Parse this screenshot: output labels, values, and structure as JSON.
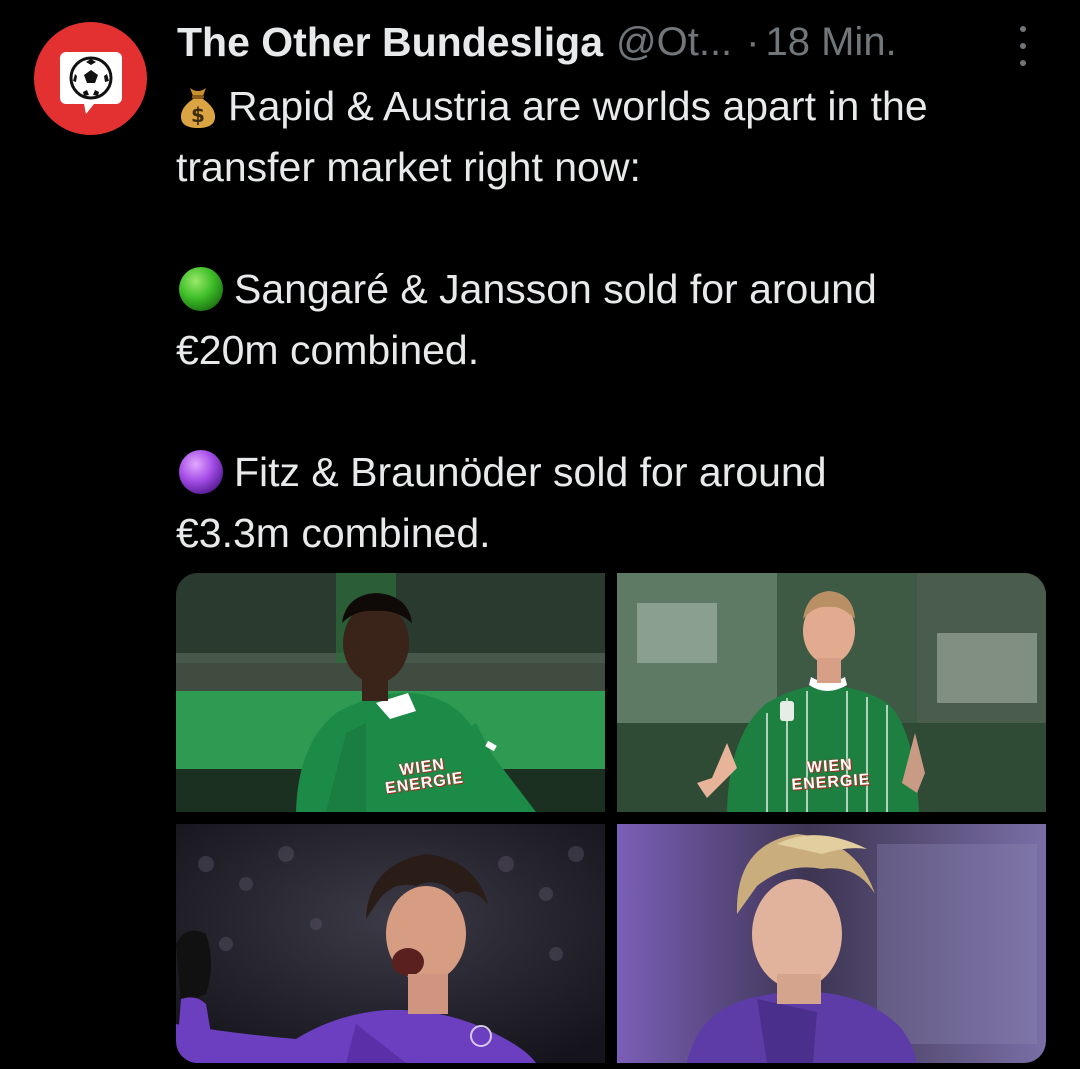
{
  "tweet": {
    "author_name": "The Other Bundesliga",
    "handle": "@Ot...",
    "separator": "·",
    "time": "18 Min.",
    "lines": [
      {
        "emoji": "money-bag",
        "text": "Rapid & Austria are worlds apart in the"
      },
      {
        "emoji": "",
        "text": "transfer market right now:"
      },
      {
        "emoji": "",
        "text": ""
      },
      {
        "emoji": "green-circle",
        "text": "Sangaré & Jansson sold for around"
      },
      {
        "emoji": "",
        "text": "€20m combined."
      },
      {
        "emoji": "",
        "text": ""
      },
      {
        "emoji": "purple-circle",
        "text": "Fitz & Braunöder sold for around"
      },
      {
        "emoji": "",
        "text": "€3.3m combined."
      }
    ]
  },
  "photos": {
    "photo1_sponsor": "WIEN ENERGIE",
    "photo2_sponsor": "WIEN ENERGIE"
  },
  "colors": {
    "background": "#000000",
    "primary_text": "#e7e9ea",
    "secondary_text": "#71767b",
    "avatar_red": "#e33131",
    "rapid_green": "#1f8a45",
    "austria_violet": "#6a3fb3"
  },
  "icons": {
    "avatar": "soccer-ball-speech-bubble-logo",
    "more": "more-vertical-icon"
  }
}
